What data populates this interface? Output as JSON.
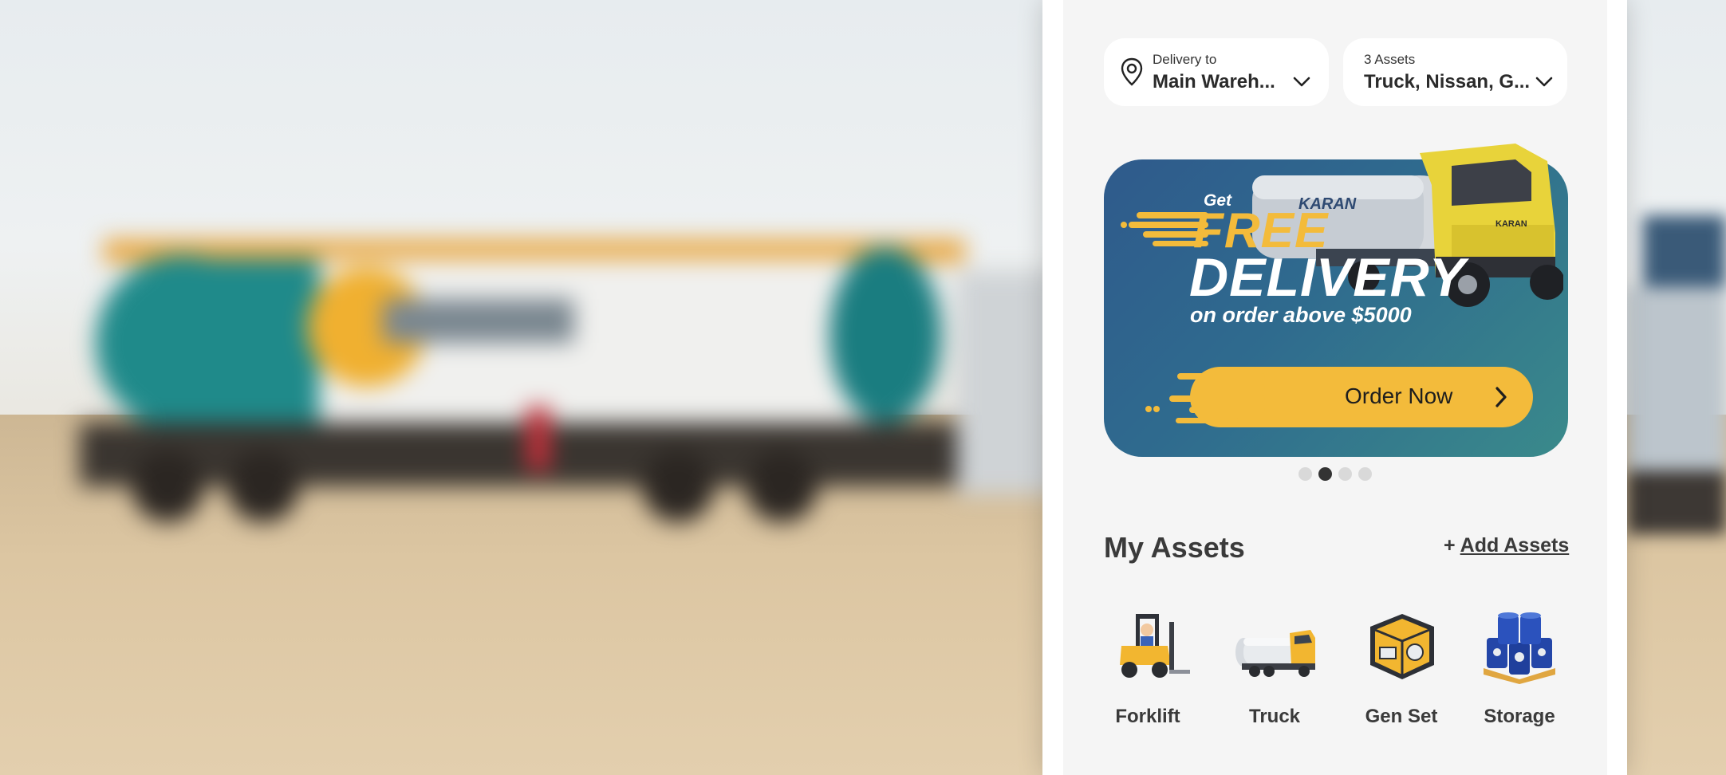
{
  "delivery": {
    "label": "Delivery to",
    "value": "Main Wareh..."
  },
  "assets_selector": {
    "label": "3 Assets",
    "value": "Truck, Nissan, G..."
  },
  "banner": {
    "get": "Get",
    "free": "FREE",
    "delivery": "DELIVERY",
    "condition": "on order above $5000",
    "button_label": "Order Now",
    "brand": "KARAN",
    "active_slide": 2,
    "slide_count": 4
  },
  "my_assets": {
    "title": "My Assets",
    "add_prefix": "+",
    "add_label": "Add Assets",
    "items": [
      {
        "label": "Forklift",
        "icon": "forklift-icon"
      },
      {
        "label": "Truck",
        "icon": "tanker-truck-icon"
      },
      {
        "label": "Gen Set",
        "icon": "generator-icon"
      },
      {
        "label": "Storage",
        "icon": "barrels-icon"
      }
    ]
  },
  "colors": {
    "accent": "#f3bb3b",
    "banner_start": "#2f5a8c",
    "banner_end": "#3a8a8b",
    "text": "#3a3a3a"
  }
}
